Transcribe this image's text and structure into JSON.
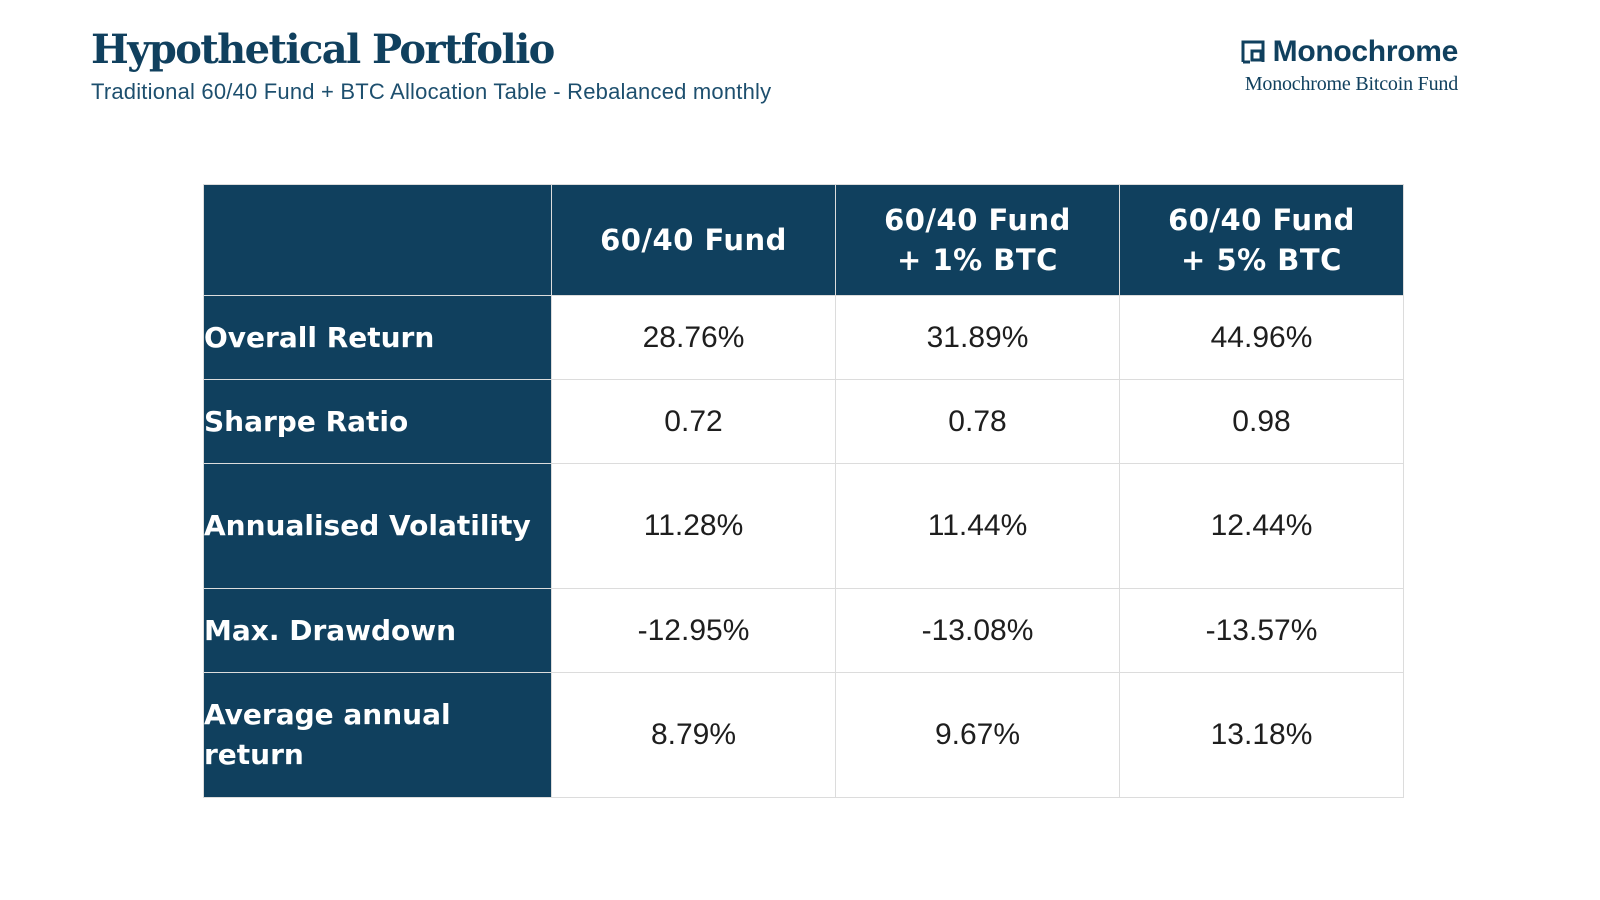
{
  "header": {
    "title": "Hypothetical Portfolio",
    "subtitle": "Traditional 60/40 Fund + BTC Allocation Table - Rebalanced monthly"
  },
  "brand": {
    "icon": "monochrome-logo-icon",
    "name": "Monochrome",
    "fund_name": "Monochrome Bitcoin Fund"
  },
  "colors": {
    "primary": "#10405e",
    "header_text": "#ffffff",
    "value_text": "#1e1e1e",
    "grid": "#dcdcdc"
  },
  "table": {
    "corner": "",
    "columns": [
      "60/40 Fund",
      "60/40 Fund\n+ 1% BTC",
      "60/40 Fund\n+ 5% BTC"
    ],
    "rows": [
      {
        "label": "Overall Return",
        "values": [
          "28.76%",
          "31.89%",
          "44.96%"
        ]
      },
      {
        "label": "Sharpe Ratio",
        "values": [
          "0.72",
          "0.78",
          "0.98"
        ]
      },
      {
        "label": "Annualised Volatility",
        "values": [
          "11.28%",
          "11.44%",
          "12.44%"
        ]
      },
      {
        "label": "Max. Drawdown",
        "values": [
          "-12.95%",
          "-13.08%",
          "-13.57%"
        ]
      },
      {
        "label": "Average annual return",
        "values": [
          "8.79%",
          "9.67%",
          "13.18%"
        ]
      }
    ]
  }
}
